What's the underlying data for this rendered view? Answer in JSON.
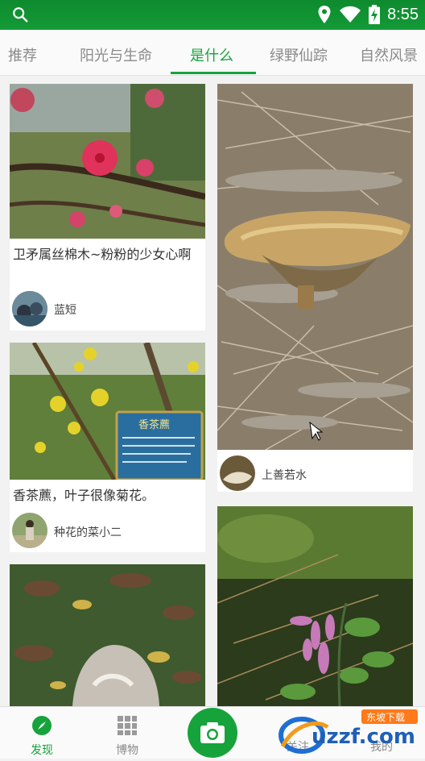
{
  "status": {
    "time": "8:55"
  },
  "tabs": [
    {
      "label": "推荐"
    },
    {
      "label": "阳光与生命"
    },
    {
      "label": "是什么"
    },
    {
      "label": "绿野仙踪"
    },
    {
      "label": "自然风景"
    }
  ],
  "cards": [
    {
      "title": "卫矛属丝棉木~粉粉的少女心啊",
      "user": "蓝短"
    },
    {
      "title": "香茶藨，叶子很像菊花。",
      "user": "种花的菜小二"
    },
    {
      "title": "",
      "user": ""
    },
    {
      "title": "",
      "user": "上善若水"
    },
    {
      "title": "",
      "user": ""
    }
  ],
  "bottom_nav": {
    "discover": "发现",
    "museum": "博物",
    "follow": "关注",
    "mine": "我的"
  },
  "watermark": {
    "text": "uzzf.com",
    "tag": "东坡下载"
  },
  "colors": {
    "accent": "#17a33b",
    "statusbar": "#0d8b2e"
  }
}
